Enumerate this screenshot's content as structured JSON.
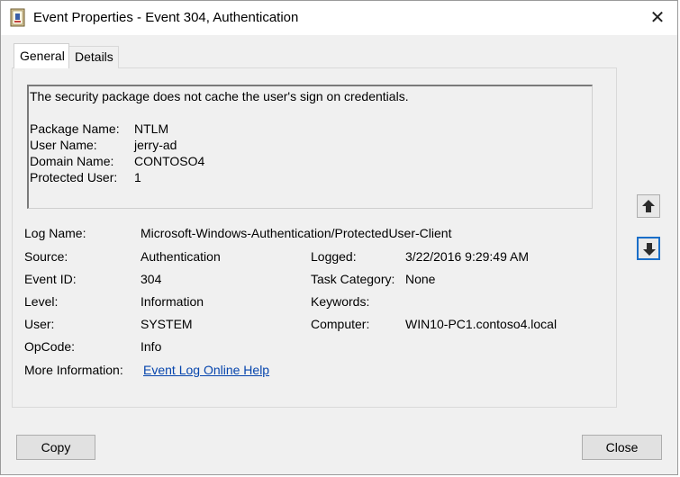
{
  "window": {
    "title": "Event Properties - Event 304, Authentication",
    "close_glyph": "✕"
  },
  "tabs": [
    {
      "label": "General",
      "selected": true
    },
    {
      "label": "Details",
      "selected": false
    }
  ],
  "description": {
    "text": "The security package does not cache the user's sign on credentials.",
    "fields": [
      {
        "key": "Package Name:",
        "value": "NTLM"
      },
      {
        "key": "User Name:",
        "value": "jerry-ad"
      },
      {
        "key": "Domain Name:",
        "value": "CONTOSO4"
      },
      {
        "key": "Protected User:",
        "value": "1"
      }
    ]
  },
  "details": {
    "log_name_label": "Log Name:",
    "log_name_value": "Microsoft-Windows-Authentication/ProtectedUser-Client",
    "source_label": "Source:",
    "source_value": "Authentication",
    "logged_label": "Logged:",
    "logged_value": "3/22/2016 9:29:49 AM",
    "event_id_label": "Event ID:",
    "event_id_value": "304",
    "task_category_label": "Task Category:",
    "task_category_value": "None",
    "level_label": "Level:",
    "level_value": "Information",
    "keywords_label": "Keywords:",
    "keywords_value": "",
    "user_label": "User:",
    "user_value": "SYSTEM",
    "computer_label": "Computer:",
    "computer_value": "WIN10-PC1.contoso4.local",
    "opcode_label": "OpCode:",
    "opcode_value": "Info",
    "more_info_label": "More Information:",
    "more_info_link": "Event Log Online Help"
  },
  "buttons": {
    "copy": "Copy",
    "close": "Close"
  },
  "icons": {
    "app": "event-log-icon",
    "up": "arrow-up-icon",
    "down": "arrow-down-icon",
    "close": "close-icon"
  },
  "colors": {
    "link": "#0645ad",
    "focus": "#1a6ec8"
  }
}
